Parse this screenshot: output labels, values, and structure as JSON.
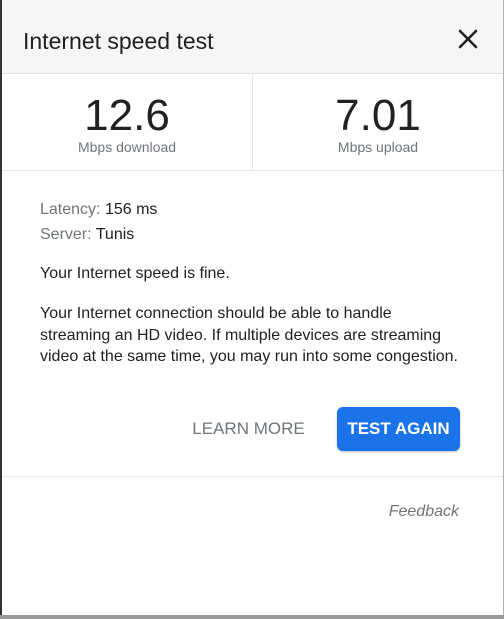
{
  "header": {
    "title": "Internet speed test",
    "close_icon": "close-icon"
  },
  "results": {
    "download": {
      "value": "12.6",
      "unit": "Mbps download"
    },
    "upload": {
      "value": "7.01",
      "unit": "Mbps upload"
    }
  },
  "info": {
    "latency_label": "Latency:",
    "latency_value": "156 ms",
    "server_label": "Server:",
    "server_value": "Tunis"
  },
  "status": "Your Internet speed is fine.",
  "description": "Your Internet connection should be able to handle streaming an HD video. If multiple devices are streaming video at the same time, you may run into some congestion.",
  "actions": {
    "learn_more": "LEARN MORE",
    "test_again": "TEST AGAIN"
  },
  "footer": {
    "feedback": "Feedback"
  },
  "colors": {
    "accent": "#1a73e8",
    "text_primary": "#202124",
    "text_secondary": "#70757a",
    "header_bg": "#f6f6f6"
  }
}
